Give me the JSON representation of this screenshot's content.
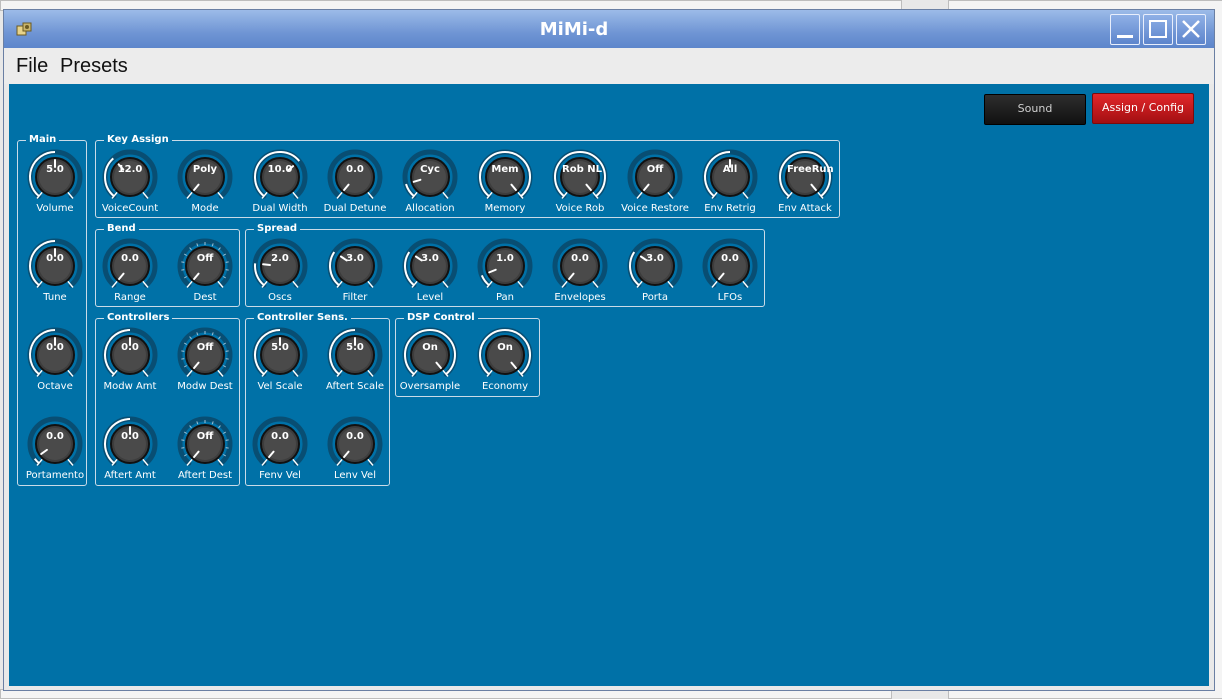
{
  "window": {
    "title": "MiMi-d"
  },
  "menu": {
    "file": "File",
    "presets": "Presets"
  },
  "buttons": {
    "sound": "Sound",
    "assign": "Assign / Config"
  },
  "colors": {
    "panel": "#0071a7",
    "knob_ring": "#084e73",
    "assign_button": "#c0161b",
    "sound_button": "#1b1b1b"
  },
  "groups": {
    "main": {
      "title": "Main",
      "knobs": [
        {
          "value": "5.0",
          "label": "Volume",
          "level": 0.5
        },
        {
          "value": "0.0",
          "label": "Tune",
          "level": 0.5
        },
        {
          "value": "0.0",
          "label": "Octave",
          "level": 0.5
        },
        {
          "value": "0.0",
          "label": "Portamento",
          "level": 0.05
        }
      ]
    },
    "key_assign": {
      "title": "Key Assign",
      "knobs": [
        {
          "value": "12.0",
          "label": "VoiceCount",
          "level": 0.35
        },
        {
          "value": "Poly",
          "label": "Mode",
          "level": 0.0
        },
        {
          "value": "10.0",
          "label": "Dual Width",
          "level": 0.68
        },
        {
          "value": "0.0",
          "label": "Dual Detune",
          "level": 0.0
        },
        {
          "value": "Cyc",
          "label": "Allocation",
          "level": 0.12
        },
        {
          "value": "Mem",
          "label": "Memory",
          "level": 1.0
        },
        {
          "value": "Rob NL",
          "label": "Voice Rob",
          "level": 1.0
        },
        {
          "value": "Off",
          "label": "Voice Restore",
          "level": 0.0
        },
        {
          "value": "All",
          "label": "Env Retrig",
          "level": 0.5
        },
        {
          "value": "FreeRun",
          "label": "Env Attack",
          "level": 1.0
        }
      ]
    },
    "bend": {
      "title": "Bend",
      "knobs": [
        {
          "value": "0.0",
          "label": "Range",
          "level": 0.0
        },
        {
          "value": "Off",
          "label": "Dest",
          "level": 0.0
        }
      ]
    },
    "spread": {
      "title": "Spread",
      "knobs": [
        {
          "value": "2.0",
          "label": "Oscs",
          "level": 0.2
        },
        {
          "value": "3.0",
          "label": "Filter",
          "level": 0.3
        },
        {
          "value": "3.0",
          "label": "Level",
          "level": 0.3
        },
        {
          "value": "1.0",
          "label": "Pan",
          "level": 0.1
        },
        {
          "value": "0.0",
          "label": "Envelopes",
          "level": 0.0
        },
        {
          "value": "3.0",
          "label": "Porta",
          "level": 0.3
        },
        {
          "value": "0.0",
          "label": "LFOs",
          "level": 0.0
        }
      ]
    },
    "controllers": {
      "title": "Controllers",
      "knobs": [
        {
          "value": "0.0",
          "label": "Modw Amt",
          "level": 0.5
        },
        {
          "value": "Off",
          "label": "Modw Dest",
          "level": 0.0
        },
        {
          "value": "0.0",
          "label": "Aftert Amt",
          "level": 0.5
        },
        {
          "value": "Off",
          "label": "Aftert Dest",
          "level": 0.0
        }
      ]
    },
    "controller_sens": {
      "title": "Controller Sens.",
      "knobs": [
        {
          "value": "5.0",
          "label": "Vel Scale",
          "level": 0.5
        },
        {
          "value": "5.0",
          "label": "Aftert Scale",
          "level": 0.5
        },
        {
          "value": "0.0",
          "label": "Fenv Vel",
          "level": 0.0
        },
        {
          "value": "0.0",
          "label": "Lenv Vel",
          "level": 0.0
        }
      ]
    },
    "dsp_control": {
      "title": "DSP Control",
      "knobs": [
        {
          "value": "On",
          "label": "Oversample",
          "level": 1.0
        },
        {
          "value": "On",
          "label": "Economy",
          "level": 1.0
        }
      ]
    }
  }
}
